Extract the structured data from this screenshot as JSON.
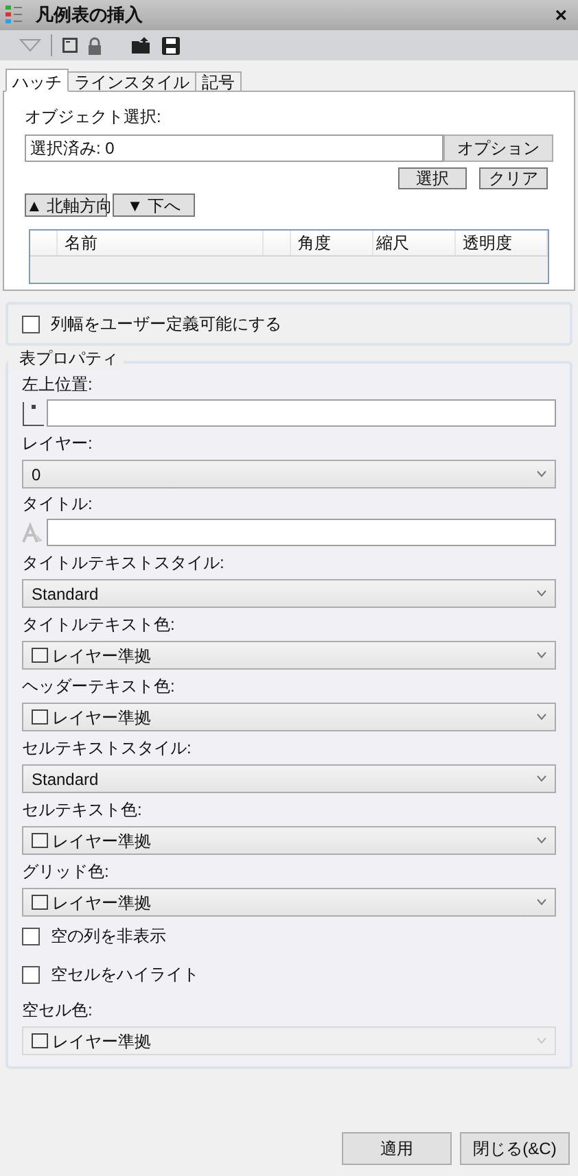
{
  "window": {
    "title": "凡例表の挿入",
    "close": "×"
  },
  "tabs": [
    {
      "label": "ハッチ",
      "selected": true
    },
    {
      "label": "ラインスタイル",
      "selected": false
    },
    {
      "label": "記号",
      "selected": false
    }
  ],
  "selection": {
    "label": "オブジェクト選択:",
    "value": "選択済み: 0",
    "option_button": "オプション",
    "buttons": [
      "選択",
      "クリア"
    ],
    "move_buttons": [
      "▲ 北軸方向",
      "▼ 下へ"
    ]
  },
  "table": {
    "columns": [
      "",
      "名前",
      "",
      "角度",
      "縮尺",
      "透明度"
    ]
  },
  "custom_width": {
    "label": "列幅をユーザー定義可能にする",
    "checked": false
  },
  "properties": {
    "title": "表プロパティ",
    "items": [
      {
        "kind": "point",
        "label": "左上位置:",
        "value": ""
      },
      {
        "kind": "dropdown",
        "label": "レイヤー:",
        "value": "0",
        "disabled": false
      },
      {
        "kind": "text",
        "label": "タイトル:",
        "value": ""
      },
      {
        "kind": "dropdown",
        "label": "タイトルテキストスタイル:",
        "value": "Standard",
        "disabled": false
      },
      {
        "kind": "color",
        "label": "タイトルテキスト色:",
        "value": "レイヤー準拠",
        "disabled": false
      },
      {
        "kind": "color",
        "label": "ヘッダーテキスト色:",
        "value": "レイヤー準拠",
        "disabled": false
      },
      {
        "kind": "dropdown",
        "label": "セルテキストスタイル:",
        "value": "Standard",
        "disabled": false
      },
      {
        "kind": "color",
        "label": "セルテキスト色:",
        "value": "レイヤー準拠",
        "disabled": false
      },
      {
        "kind": "color",
        "label": "グリッド色:",
        "value": "レイヤー準拠",
        "disabled": false
      },
      {
        "kind": "checkbox",
        "label": "空の列を非表示",
        "checked": false
      },
      {
        "kind": "checkbox",
        "label": "空セルをハイライト",
        "checked": false
      },
      {
        "kind": "color",
        "label": "空セル色:",
        "value": "レイヤー準拠",
        "disabled": true
      }
    ]
  },
  "footer": {
    "buttons": [
      "適用",
      "閉じる(&C)"
    ]
  }
}
